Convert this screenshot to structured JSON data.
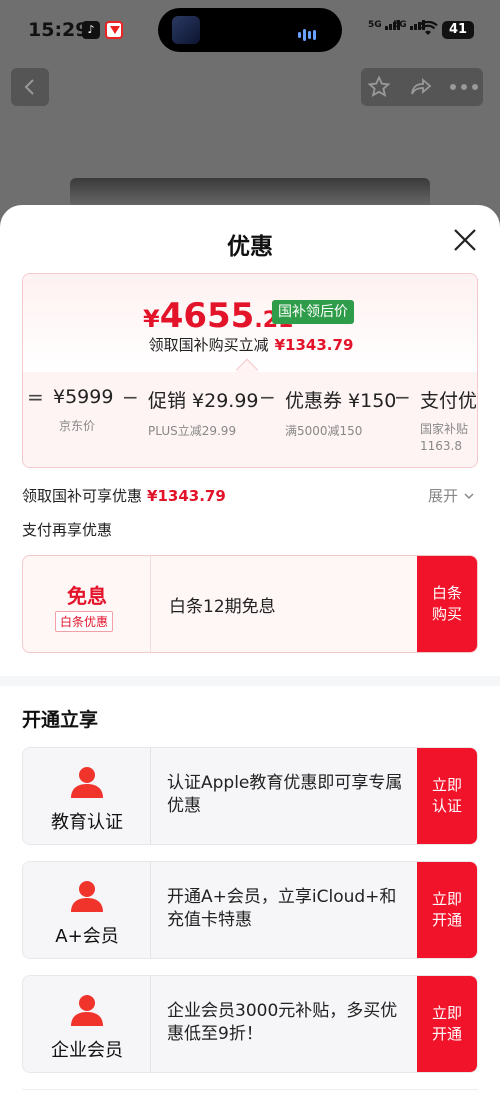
{
  "status_bar": {
    "time": "15:29",
    "signal1": "5G",
    "signal2": "5G",
    "battery": "41",
    "icons": [
      "tiktok-icon",
      "red-app-icon",
      "wifi-icon"
    ]
  },
  "nav": {
    "icons": [
      "back-icon",
      "star-icon",
      "share-icon",
      "more-icon"
    ]
  },
  "sheet": {
    "title": "优惠",
    "price": {
      "symbol": "¥",
      "integer": "4655",
      "decimal": ".21",
      "tag": "国补领后价",
      "claim_label": "领取国补购买立减",
      "claim_amount": "¥1343.79"
    },
    "calc": [
      {
        "op": "=",
        "main": "¥5999",
        "sub": "京东价"
      },
      {
        "op": "−",
        "main": "促销 ¥29.99",
        "sub": "PLUS立减29.99"
      },
      {
        "op": "−",
        "main": "优惠券 ¥150",
        "sub": "满5000减150"
      },
      {
        "op": "−",
        "main": "支付优惠",
        "sub": "国家补贴",
        "sub2": "1163.8"
      }
    ],
    "enjoy": {
      "label": "领取国补可享优惠",
      "amount": "¥1343.79",
      "expand": "展开"
    },
    "pay_title": "支付再享优惠",
    "baitiao": {
      "big": "免息",
      "tag": "白条优惠",
      "text": "白条12期免息",
      "action": "白条购买"
    },
    "open_title": "开通立享",
    "offers": [
      {
        "name": "教育认证",
        "text": "认证Apple教育优惠即可享专属优惠",
        "action": "立即认证"
      },
      {
        "name": "A+会员",
        "text": "开通A+会员，立享iCloud+和充值卡特惠",
        "action": "立即开通"
      },
      {
        "name": "企业会员",
        "text": "企业会员3000元补贴，多买优惠低至9折！",
        "action": "立即开通"
      }
    ]
  },
  "colors": {
    "accent": "#e3132a",
    "tag_green": "#2f9c4a",
    "action_red": "#f0132a"
  }
}
